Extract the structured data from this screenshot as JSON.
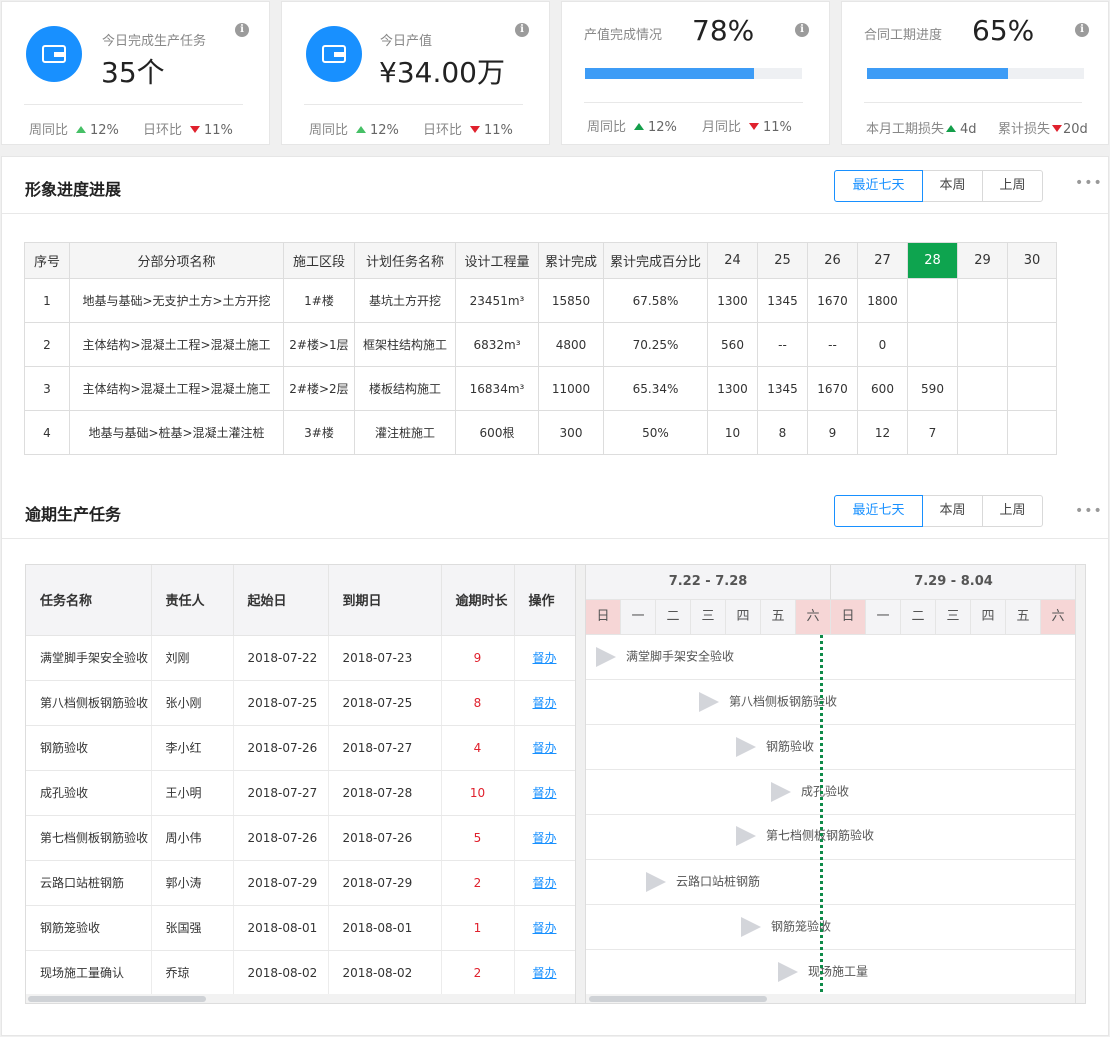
{
  "kpis": [
    {
      "label": "今日完成生产任务",
      "value": "35个",
      "foot1_label": "周同比",
      "foot1_value": "12%",
      "foot2_label": "日环比",
      "foot2_value": "11%"
    },
    {
      "label": "今日产值",
      "value": "¥34.00万",
      "foot1_label": "周同比",
      "foot1_value": "12%",
      "foot2_label": "日环比",
      "foot2_value": "11%"
    },
    {
      "label": "产值完成情况",
      "value": "78%",
      "progress": 0.78,
      "foot1_label": "周同比",
      "foot1_value": "12%",
      "foot2_label": "月同比",
      "foot2_value": "11%"
    },
    {
      "label": "合同工期进度",
      "value": "65%",
      "progress": 0.65,
      "foot1_label": "本月工期损失",
      "foot1_value": "4d",
      "foot2_label": "累计损失",
      "foot2_value": "20d"
    }
  ],
  "tabs": [
    "最近七天",
    "本周",
    "上周"
  ],
  "progress_section": {
    "title": "形象进度进展",
    "headers": [
      "序号",
      "分部分项名称",
      "施工区段",
      "计划任务名称",
      "设计工程量",
      "累计完成",
      "累计完成百分比",
      "24",
      "25",
      "26",
      "27",
      "28",
      "29",
      "30"
    ],
    "rows": [
      [
        "1",
        "地基与基础>无支护土方>土方开挖",
        "1#楼",
        "基坑土方开挖",
        "23451m³",
        "15850",
        "67.58%",
        "1300",
        "1345",
        "1670",
        "1800",
        "",
        "",
        ""
      ],
      [
        "2",
        "主体结构>混凝土工程>混凝土施工",
        "2#楼>1层",
        "框架柱结构施工",
        "6832m³",
        "4800",
        "70.25%",
        "560",
        "--",
        "--",
        "0",
        "",
        "",
        ""
      ],
      [
        "3",
        "主体结构>混凝土工程>混凝土施工",
        "2#楼>2层",
        "楼板结构施工",
        "16834m³",
        "11000",
        "65.34%",
        "1300",
        "1345",
        "1670",
        "600",
        "590",
        "",
        ""
      ],
      [
        "4",
        "地基与基础>桩基>混凝土灌注桩",
        "3#楼",
        "灌注桩施工",
        "600根",
        "300",
        "50%",
        "10",
        "8",
        "9",
        "12",
        "7",
        "",
        ""
      ]
    ]
  },
  "overdue_section": {
    "title": "逾期生产任务",
    "headers": [
      "任务名称",
      "责任人",
      "起始日",
      "到期日",
      "逾期时长",
      "操作"
    ],
    "rows": [
      [
        "满堂脚手架安全验收",
        "刘刚",
        "2018-07-22",
        "2018-07-23",
        "9",
        "督办"
      ],
      [
        "第八档侧板钢筋验收",
        "张小刚",
        "2018-07-25",
        "2018-07-25",
        "8",
        "督办"
      ],
      [
        "钢筋验收",
        "李小红",
        "2018-07-26",
        "2018-07-27",
        "4",
        "督办"
      ],
      [
        "成孔验收",
        "王小明",
        "2018-07-27",
        "2018-07-28",
        "10",
        "督办"
      ],
      [
        "第七档侧板钢筋验收",
        "周小伟",
        "2018-07-26",
        "2018-07-26",
        "5",
        "督办"
      ],
      [
        "云路口站桩钢筋",
        "郭小涛",
        "2018-07-29",
        "2018-07-29",
        "2",
        "督办"
      ],
      [
        "钢筋笼验收",
        "张国强",
        "2018-08-01",
        "2018-08-01",
        "1",
        "督办"
      ],
      [
        "现场施工量确认",
        "乔琼",
        "2018-08-02",
        "2018-08-02",
        "2",
        "督办"
      ]
    ],
    "weeks": [
      "7.22 - 7.28",
      "7.29 - 8.04"
    ],
    "days": [
      "日",
      "一",
      "二",
      "三",
      "四",
      "五",
      "六",
      "日",
      "一",
      "二",
      "三",
      "四",
      "五",
      "六"
    ],
    "gantt_labels": [
      "满堂脚手架安全验收",
      "第八档侧板钢筋验收",
      "钢筋验收",
      "成孔验收",
      "第七档侧板钢筋验收",
      "云路口站桩钢筋",
      "钢筋笼验收",
      "现场施工量"
    ]
  },
  "colors": {
    "accent": "#1890ff",
    "today": "#0ea44f",
    "up": "#46c066",
    "down": "#e0212d",
    "weekend": "#f6d6d6"
  }
}
